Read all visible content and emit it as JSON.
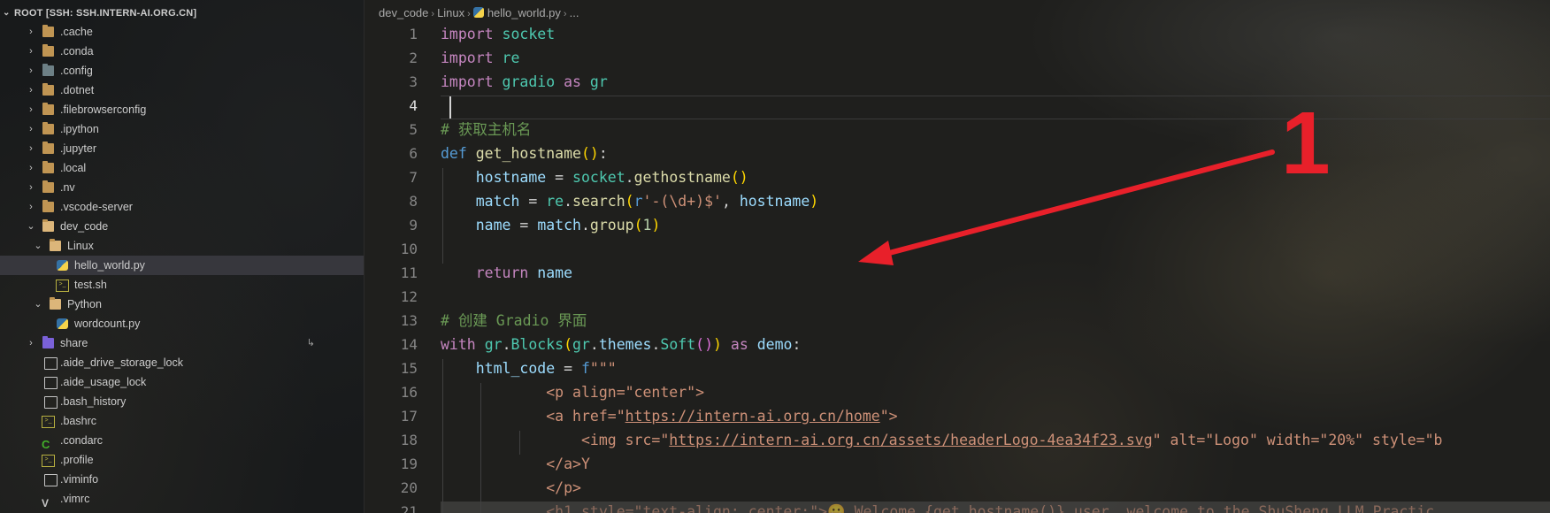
{
  "sidebar": {
    "root_label": "ROOT [SSH: SSH.INTERN-AI.ORG.CN]",
    "items": [
      {
        "label": ".cache",
        "icon": "folder-icon"
      },
      {
        "label": ".conda",
        "icon": "folder-icon"
      },
      {
        "label": ".config",
        "icon": "folder-config-icon"
      },
      {
        "label": ".dotnet",
        "icon": "folder-icon"
      },
      {
        "label": ".filebrowserconfig",
        "icon": "folder-icon"
      },
      {
        "label": ".ipython",
        "icon": "folder-icon"
      },
      {
        "label": ".jupyter",
        "icon": "folder-icon"
      },
      {
        "label": ".local",
        "icon": "folder-icon"
      },
      {
        "label": ".nv",
        "icon": "folder-icon"
      },
      {
        "label": ".vscode-server",
        "icon": "folder-icon"
      },
      {
        "label": "dev_code",
        "icon": "folder-open-icon"
      },
      {
        "label": "Linux",
        "icon": "folder-open-icon"
      },
      {
        "label": "hello_world.py",
        "icon": "python-file-icon"
      },
      {
        "label": "test.sh",
        "icon": "shell-file-icon"
      },
      {
        "label": "Python",
        "icon": "folder-open-icon"
      },
      {
        "label": "wordcount.py",
        "icon": "python-file-icon"
      },
      {
        "label": "share",
        "icon": "folder-share-icon"
      },
      {
        "label": ".aide_drive_storage_lock",
        "icon": "file-icon"
      },
      {
        "label": ".aide_usage_lock",
        "icon": "file-icon"
      },
      {
        "label": ".bash_history",
        "icon": "file-icon"
      },
      {
        "label": ".bashrc",
        "icon": "shell-file-icon"
      },
      {
        "label": ".condarc",
        "icon": "conda-file-icon"
      },
      {
        "label": ".profile",
        "icon": "shell-file-icon"
      },
      {
        "label": ".viminfo",
        "icon": "file-icon"
      },
      {
        "label": ".vimrc",
        "icon": "vim-file-icon"
      }
    ]
  },
  "breadcrumb": {
    "part1": "dev_code",
    "part2": "Linux",
    "part3": "hello_world.py",
    "part4": "..."
  },
  "editor": {
    "line_numbers": [
      "1",
      "2",
      "3",
      "4",
      "5",
      "6",
      "7",
      "8",
      "9",
      "10",
      "11",
      "12",
      "13",
      "14",
      "15",
      "16",
      "17",
      "18",
      "19",
      "20",
      "21"
    ],
    "active_line": "4",
    "code": {
      "l1_kw": "import",
      "l1_mod": "socket",
      "l2_kw": "import",
      "l2_mod": "re",
      "l3_kw": "import",
      "l3_mod": "gradio",
      "l3_as": "as",
      "l3_alias": "gr",
      "l5_cmt": "# 获取主机名",
      "l6_def": "def",
      "l6_fn": "get_hostname",
      "l6_rest": ":",
      "l7_var": "hostname",
      "l7_eq": " = ",
      "l7_mod": "socket",
      "l7_fn": "gethostname",
      "l8_var": "match",
      "l8_eq": " = ",
      "l8_mod": "re",
      "l8_fn": "search",
      "l8_r": "r",
      "l8_str": "'-(\\d+)$'",
      "l8_comma": ", ",
      "l8_arg": "hostname",
      "l9_var": "name",
      "l9_eq": " = ",
      "l9_obj": "match",
      "l9_fn": "group",
      "l9_num": "1",
      "l11_kw": "return",
      "l11_var": "name",
      "l13_cmt": "# 创建 Gradio 界面",
      "l14_kw": "with",
      "l14_a": "gr",
      "l14_fn": "Blocks",
      "l14_b": "gr",
      "l14_c": "themes",
      "l14_fn2": "Soft",
      "l14_as": "as",
      "l14_var": "demo",
      "l14_colon": ":",
      "l15_var": "html_code",
      "l15_eq": " = ",
      "l15_f": "f",
      "l15_str": "\"\"\"",
      "l16": "<p align=\"center\">",
      "l17_pre": "<a href=\"",
      "l17_url": "https://intern-ai.org.cn/home",
      "l17_post": "\">",
      "l18_pre": "<img src=\"",
      "l18_url": "https://intern-ai.org.cn/assets/headerLogo-4ea34f23.svg",
      "l18_post": "\" alt=\"Logo\" width=\"20%\" style=\"b",
      "l19": "</a>Y",
      "l20": "</p>",
      "l21": "<h1 style=\"text-align: center;\">😀 Welcome {get_hostname()} user, welcome to the ShuSheng LLM Practic"
    }
  },
  "annotation": {
    "label": "1",
    "color": "#e8202a"
  }
}
